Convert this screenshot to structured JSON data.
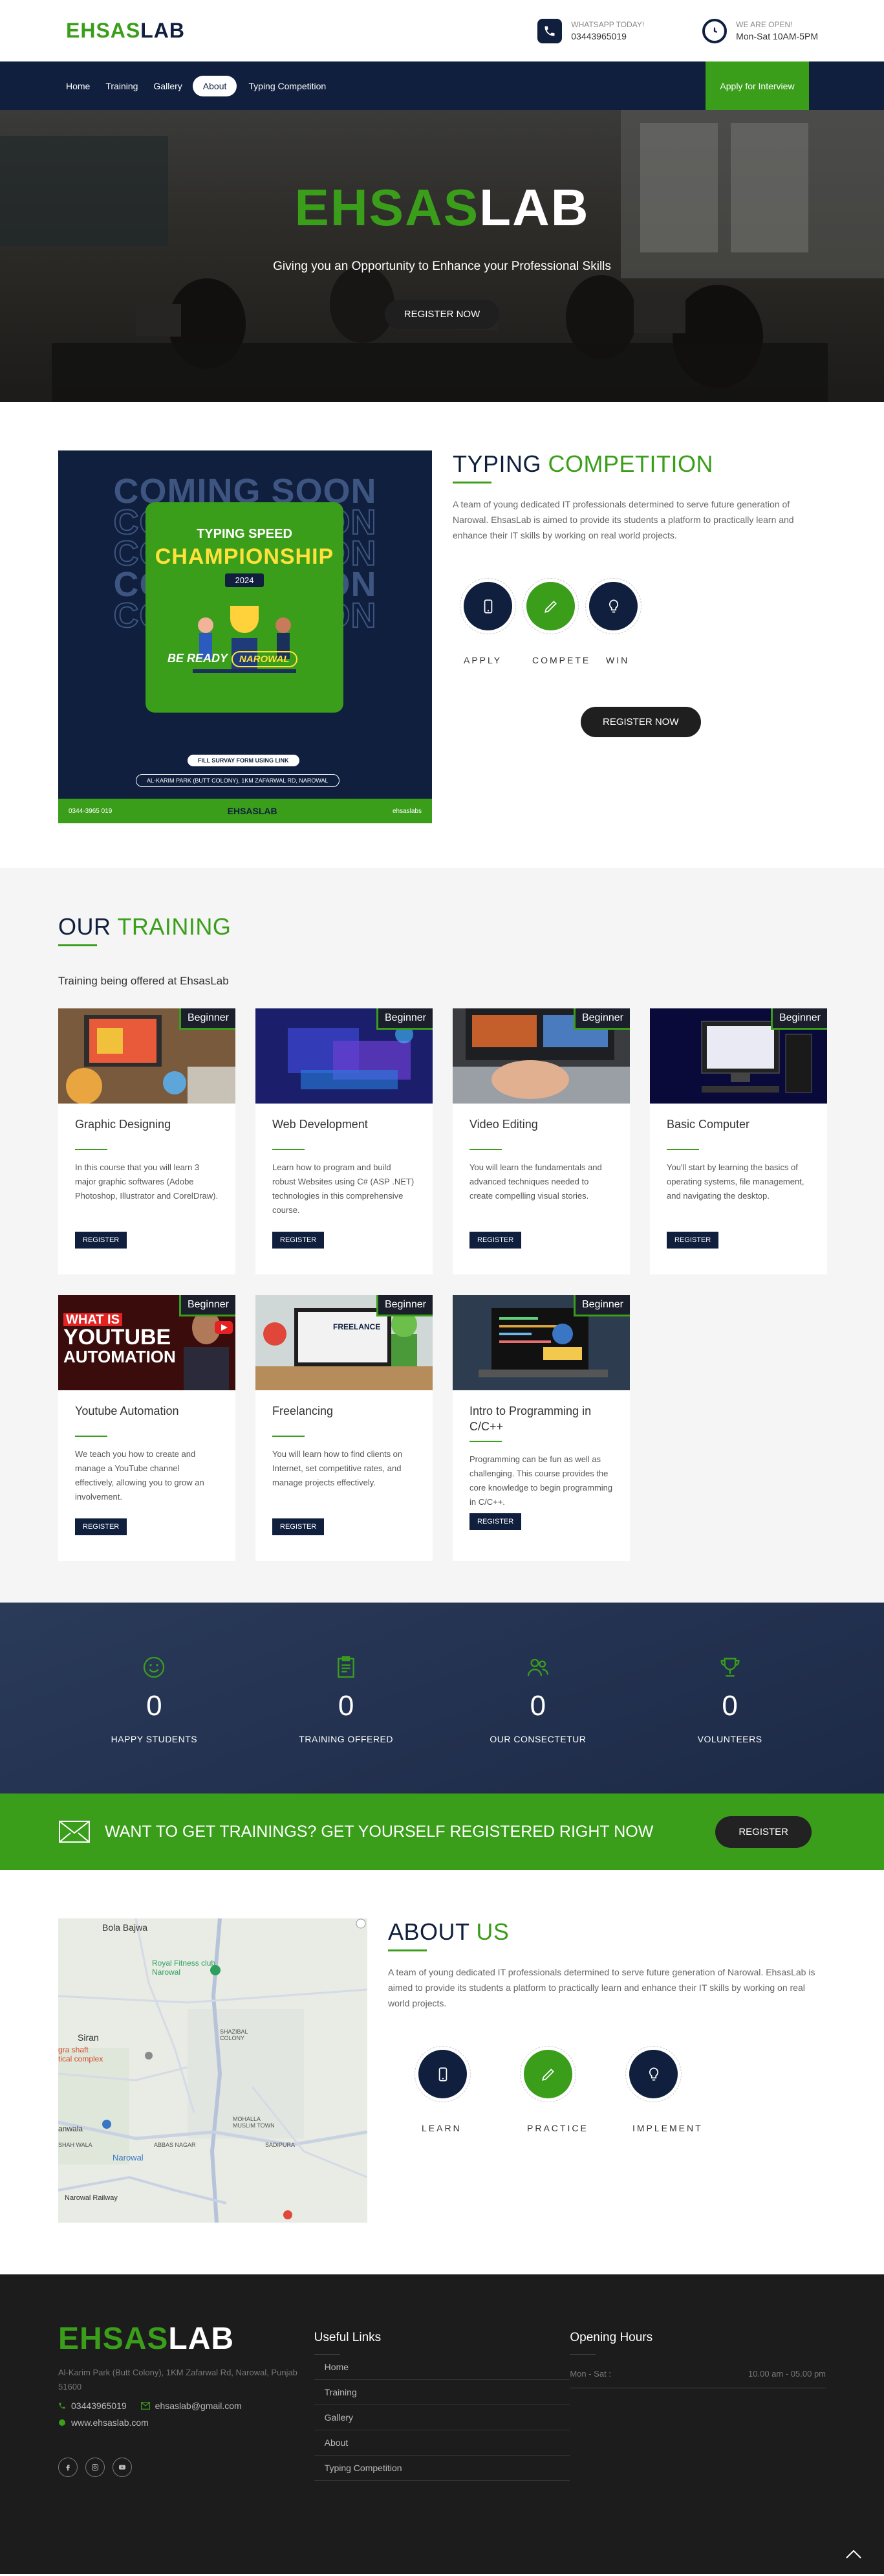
{
  "header": {
    "logo_green": "EHSAS",
    "logo_navy": "LAB",
    "whatsapp_label": "WHATSAPP TODAY!",
    "whatsapp_number": "03443965019",
    "open_label": "WE ARE OPEN!",
    "open_hours": "Mon-Sat 10AM-5PM"
  },
  "nav": {
    "items": [
      "Home",
      "Training",
      "Gallery",
      "About",
      "Typing Competition"
    ],
    "active": "About",
    "apply": "Apply for Interview"
  },
  "hero": {
    "title_green": "EHSAS",
    "title_white": "LAB",
    "subtitle": "Giving you an Opportunity to Enhance your Professional Skills",
    "button": "REGISTER NOW"
  },
  "typing": {
    "title_navy": "TYPING",
    "title_green": "COMPETITION",
    "paragraph": "A team of young dedicated IT professionals determined to serve future generation of Narowal. EhsasLab is aimed to provide its students a platform to practically learn and enhance their IT skills by working on real world projects.",
    "labels": [
      "APPLY",
      "COMPETE",
      "WIN"
    ],
    "button": "REGISTER NOW",
    "poster": {
      "coming_soon": "COMING SOON",
      "line1": "TYPING SPEED",
      "line2": "CHAMPIONSHIP",
      "year": "2024",
      "be_ready": "BE READY",
      "city": "NAROWAL",
      "survey": "FILL SURVAY FORM USING LINK",
      "address": "AL-KARIM PARK (BUTT COLONY), 1KM ZAFARWAL RD, NAROWAL",
      "phone": "0344-3965 019",
      "brand": "EHSASLAB",
      "handle": "ehsaslabs"
    }
  },
  "training": {
    "title_navy": "OUR",
    "title_green": "TRAINING",
    "subtitle": "Training being offered at EhsasLab",
    "badge": "Beginner",
    "register": "REGISTER",
    "courses": [
      {
        "title": "Graphic Designing",
        "desc": "In this course that you will learn 3 major graphic softwares (Adobe Photoshop, Illustrator and CorelDraw)."
      },
      {
        "title": "Web Development",
        "desc": "Learn how to program and build robust Websites using C# (ASP .NET) technologies in this comprehensive course."
      },
      {
        "title": "Video Editing",
        "desc": "You will learn the fundamentals and advanced techniques needed to create compelling visual stories."
      },
      {
        "title": "Basic Computer",
        "desc": "You'll start by learning the basics of operating systems, file management, and navigating the desktop."
      },
      {
        "title": "Youtube Automation",
        "desc": "We teach you how to create and manage a YouTube channel effectively, allowing you to grow an involvement."
      },
      {
        "title": "Freelancing",
        "desc": "You will learn how to find clients on Internet, set competitive rates, and manage projects effectively."
      },
      {
        "title": "Intro to Programming in C/C++",
        "desc": "Programming can be fun as well as challenging. This course provides the core knowledge to begin programming in C/C++."
      }
    ],
    "thumb_text": {
      "yt_line1": "WHAT IS",
      "yt_line2": "YOUTUBE",
      "yt_line3": "AUTOMATION",
      "freelance": "FREELANCE"
    }
  },
  "stats": [
    {
      "value": "0",
      "label": "HAPPY STUDENTS",
      "icon": "smile-icon"
    },
    {
      "value": "0",
      "label": "TRAINING OFFERED",
      "icon": "clipboard-icon"
    },
    {
      "value": "0",
      "label": "OUR CONSECTETUR",
      "icon": "users-icon"
    },
    {
      "value": "0",
      "label": "VOLUNTEERS",
      "icon": "trophy-icon"
    }
  ],
  "cta": {
    "text": "WANT TO GET TRAININGS? GET YOURSELF REGISTERED RIGHT NOW",
    "button": "REGISTER"
  },
  "about": {
    "title_navy": "ABOUT",
    "title_green": "US",
    "paragraph": "A team of young dedicated IT professionals determined to serve future generation of Narowal. EhsasLab is aimed to provide its students a platform to practically learn and enhance their IT skills by working on real world projects.",
    "labels": [
      "LEARN",
      "PRACTICE",
      "IMPLEMENT"
    ],
    "map_labels": {
      "bola_bajwa": "Bola Bajwa",
      "royal_fitness": "Royal Fitness club Narowal",
      "shazibal": "SHAZIBAL COLONY",
      "siran": "Siran",
      "tical": "tical complex",
      "mohalla": "MOHALLA MUSLIM TOWN",
      "abbas": "ABBAS NAGAR",
      "sadipura": "SADIPURA",
      "anwala": "anwala",
      "shah_wala": "SHAH WALA",
      "narowal": "Narowal",
      "railway": "Narowal Railway",
      "gra_shaft": "gra shaft"
    }
  },
  "footer": {
    "logo_green": "EHSAS",
    "logo_white": "LAB",
    "address": "Al-Karim Park (Butt Colony), 1KM Zafarwal Rd, Narowal, Punjab 51600",
    "phone": "03443965019",
    "email": "ehsaslab@gmail.com",
    "website": "www.ehsaslab.com",
    "links_title": "Useful Links",
    "links": [
      "Home",
      "Training",
      "Gallery",
      "About",
      "Typing Competition"
    ],
    "hours_title": "Opening Hours",
    "hours_day": "Mon - Sat :",
    "hours_time": "10.00 am - 05.00 pm"
  },
  "colors": {
    "brand_green": "#3a9e1b",
    "navy": "#0f1f3d"
  }
}
